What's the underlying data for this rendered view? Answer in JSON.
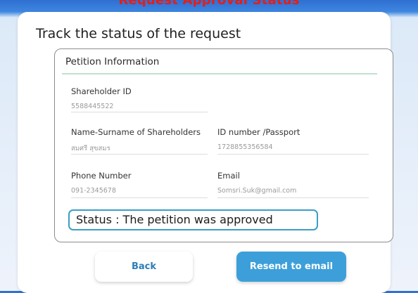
{
  "header": {
    "title": "Request Approval Status"
  },
  "card": {
    "title": "Track the status of the request",
    "section_title": "Petition Information"
  },
  "fields": {
    "shareholder_id": {
      "label": "Shareholder ID",
      "value": "5588445522"
    },
    "name": {
      "label": "Name-Surname of Shareholders",
      "value": "สมศรี สุขสมร"
    },
    "id_number": {
      "label": "ID number /Passport",
      "value": "1728855356584"
    },
    "phone": {
      "label": "Phone Number",
      "value": "091-2345678"
    },
    "email": {
      "label": "Email",
      "value": "Somsri.Suk@gmail.com"
    }
  },
  "status": {
    "text": "Status : The petition was approved"
  },
  "buttons": {
    "back": "Back",
    "resend": "Resend to email"
  },
  "colors": {
    "accent": "#3d9fd9",
    "status_border": "#3c9ec6",
    "header_red": "#e0201b",
    "section_line": "#bfe3cf"
  }
}
